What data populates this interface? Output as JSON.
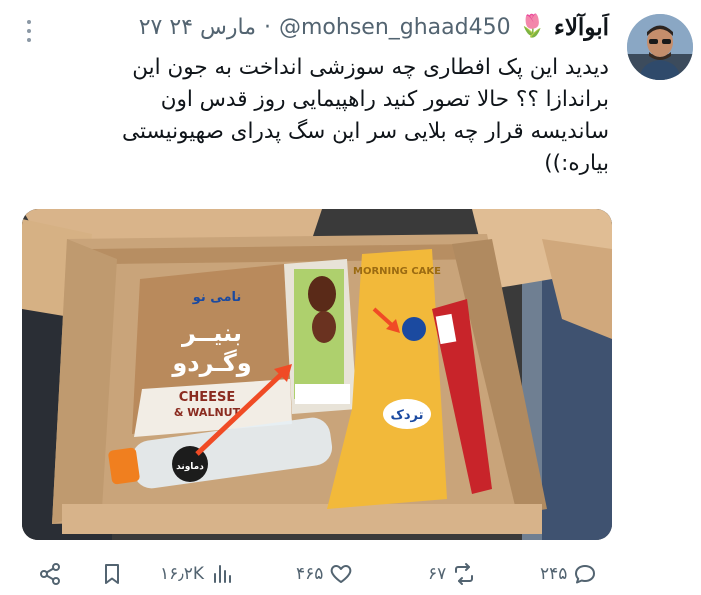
{
  "author": {
    "name": "اَبوآلاء",
    "emoji": "🌷",
    "handle": "@mohsen_ghaad450",
    "separator": "·",
    "date": "۲۷ مارس ۲۴"
  },
  "tweet": {
    "lines": [
      "دیدید این پک افطاری چه سوزشی انداخت به جون این",
      "براندازا ؟؟ حالا تصور کنید راهپیمایی روز قدس اون",
      "ساندیسه قرار چه بلایی سر این سگ پدرای صهیونیستی",
      "بیاره:))"
    ]
  },
  "media": {
    "packages": {
      "cheese_brand": "نامی نو",
      "cheese_fa_1": "بنیــر",
      "cheese_fa_2": "وگـردو",
      "cheese_en_1": "CHEESE",
      "cheese_en_2": "& WALNUT",
      "cake_brand": "تردک",
      "cake_top": "MORNING CAKE",
      "bottle_label": "دماوند"
    },
    "colors": {
      "arrow": "#f04b25",
      "cardboard": "#c9a47a",
      "cake_wrapper": "#f2b93a",
      "red_wrapper": "#c8242a"
    }
  },
  "actions": {
    "share_icon": "share-icon",
    "bookmark_icon": "bookmark-icon",
    "views": "۱۶٫۲K",
    "likes": "۴۶۵",
    "retweets": "۶۷",
    "replies": "۲۴۵"
  }
}
